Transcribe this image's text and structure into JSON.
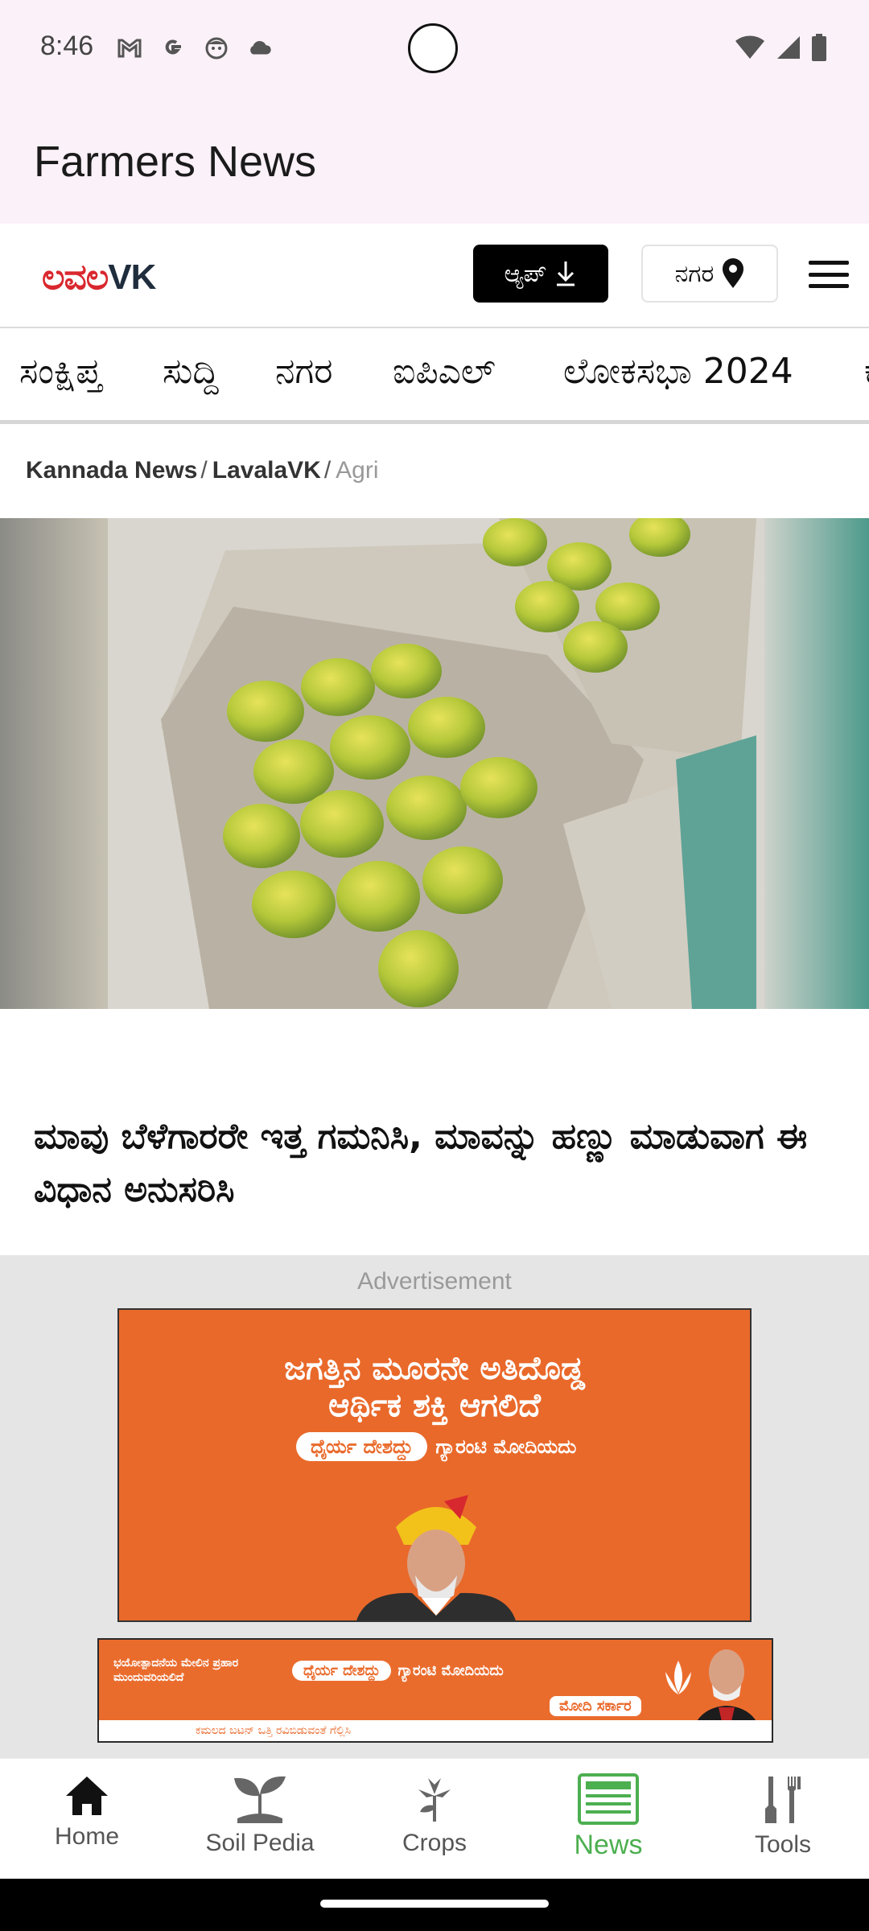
{
  "status_bar": {
    "time": "8:46",
    "icons_left": [
      "gmail-icon",
      "google-icon",
      "face-icon",
      "cloud-icon"
    ],
    "icons_right": [
      "wifi-icon",
      "signal-icon",
      "battery-icon"
    ]
  },
  "app_bar": {
    "title": "Farmers News"
  },
  "site_header": {
    "logo_red": "ಲವಲ",
    "logo_black": "VK",
    "app_button_label": "ಆ್ಯಪ್",
    "city_button_label": "ನಗರ"
  },
  "nav_tabs": [
    "ಸಂಕ್ಷಿಪ್ತ",
    "ಸುದ್ದಿ",
    "ನಗರ",
    "ಐಪಿಎಲ್",
    "ಲೋಕಸಭಾ 2024",
    "ಕ"
  ],
  "breadcrumb": {
    "item1": "Kannada News",
    "item2": "LavalaVK",
    "item3": "Agri",
    "sep": "/"
  },
  "article": {
    "headline": "ಮಾವು ಬೆಳೆಗಾರರೇ ಇತ್ತ ಗಮನಿಸಿ, ಮಾವನ್ನು ಹಣ್ಣು ಮಾಡುವಾಗ ಈ ವಿಧಾನ ಅನುಸರಿಸಿ"
  },
  "ad": {
    "label": "Advertisement",
    "main_line1": "ಜಗತ್ತಿನ ಮೂರನೇ ಅತಿದೊಡ್ಡ",
    "main_line2": "ಆರ್ಥಿಕ ಶಕ್ತಿ ಆಗಲಿದೆ",
    "main_pill": "ಧೈರ್ಯ ದೇಶದ್ದು",
    "main_pill_suffix": "ಗ್ಯಾರಂಟಿ ಮೋದಿಯದು",
    "banner_small": "ಭಯೋತ್ಪಾದನೆಯ ಮೇಲಿನ ಪ್ರಹಾರ ಮುಂದುವರಿಯಲಿದೆ",
    "banner_pill": "ಧೈರ್ಯ ದೇಶದ್ದು",
    "banner_pill_suffix": "ಗ್ಯಾರಂಟಿ ಮೋದಿಯದು",
    "banner_badge": "ಮೋದಿ ಸರ್ಕಾರ",
    "banner_strip": "ಕಮಲದ ಬಟನ್ ಒತ್ತಿ ರವಿಬಿಡುವಂತೆ ಗೆಲ್ಲಿಸಿ"
  },
  "bottom_nav": [
    {
      "label": "Home",
      "icon": "home-icon"
    },
    {
      "label": "Soil Pedia",
      "icon": "sprout-icon"
    },
    {
      "label": "Crops",
      "icon": "crop-flower-icon"
    },
    {
      "label": "News",
      "icon": "newspaper-icon",
      "active": true
    },
    {
      "label": "Tools",
      "icon": "tools-icon"
    }
  ],
  "colors": {
    "accent": "#4caf50",
    "appbar": "#fbf1f8",
    "logo_red": "#d9272e",
    "ad_orange": "#e9692a"
  }
}
